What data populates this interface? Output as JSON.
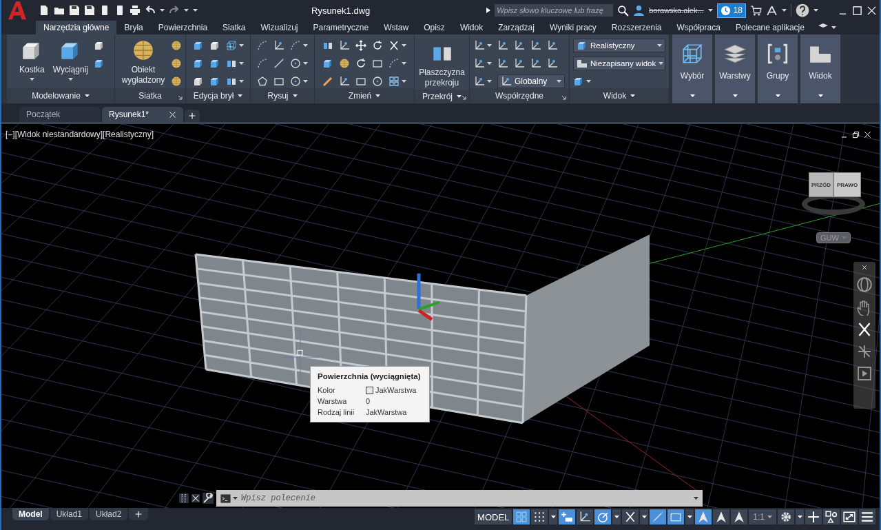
{
  "title_bar": {
    "title": "Rysunek1.dwg",
    "search": {
      "placeholder": "Wpisz słowo kluczowe lub frazę"
    },
    "user": "borawska.alek...",
    "badge": "18"
  },
  "ribbon_tabs": [
    {
      "label": "Narzędzia główne",
      "selected": true
    },
    {
      "label": "Bryła",
      "selected": false
    },
    {
      "label": "Powierzchnia",
      "selected": false
    },
    {
      "label": "Siatka",
      "selected": false
    },
    {
      "label": "Wizualizuj",
      "selected": false
    },
    {
      "label": "Parametryczne",
      "selected": false
    },
    {
      "label": "Wstaw",
      "selected": false
    },
    {
      "label": "Opisz",
      "selected": false
    },
    {
      "label": "Widok",
      "selected": false
    },
    {
      "label": "Zarządzaj",
      "selected": false
    },
    {
      "label": "Wyniki pracy",
      "selected": false
    },
    {
      "label": "Rozszerzenia",
      "selected": false
    },
    {
      "label": "Współpraca",
      "selected": false
    },
    {
      "label": "Polecane aplikacje",
      "selected": false
    }
  ],
  "ribbon_panels": [
    {
      "kind": "modeling",
      "title": "Modelowanie",
      "menu": true,
      "launcher": false,
      "buttons": [
        "Kostka",
        "Wyciągnij"
      ]
    },
    {
      "kind": "mesh",
      "title": "Siatka",
      "menu": false,
      "launcher": true,
      "buttons": [
        "Obiekt wygładzony"
      ]
    },
    {
      "kind": "solid-edit",
      "title": "Edycja brył",
      "menu": true,
      "launcher": false
    },
    {
      "kind": "draw",
      "title": "Rysuj",
      "menu": true,
      "launcher": false
    },
    {
      "kind": "modify",
      "title": "Zmień",
      "menu": true,
      "launcher": false
    },
    {
      "kind": "section",
      "title": "Przekrój",
      "menu": true,
      "launcher": true,
      "buttons": [
        "Płaszczyzna przekroju"
      ]
    },
    {
      "kind": "coords",
      "title": "Współrzędne",
      "menu": false,
      "launcher": true,
      "select": [
        "Globalny"
      ]
    },
    {
      "kind": "view",
      "title": "Widok",
      "menu": true,
      "launcher": false,
      "select": [
        "Realistyczny",
        "Niezapisany widok"
      ]
    },
    {
      "kind": "selection",
      "label": "Wybór"
    },
    {
      "kind": "layers",
      "label": "Warstwy"
    },
    {
      "kind": "groups",
      "label": "Grupy"
    },
    {
      "kind": "views",
      "label": "Widok"
    }
  ],
  "doc_tabs": [
    {
      "label": "Początek",
      "selected": false
    },
    {
      "label": "Rysunek1*",
      "selected": true
    }
  ],
  "viewport": {
    "label": "[−][Widok niestandardowy][Realistyczny]",
    "view_cube": {
      "faces": [
        "PRZÓD",
        "PRAWO"
      ]
    },
    "ucs_menu": "GUW"
  },
  "tooltip": {
    "title": "Powierzchnia (wyciągnięta)",
    "rows": [
      {
        "label": "Kolor",
        "value": "JakWarstwa",
        "swatch": true
      },
      {
        "label": "Warstwa",
        "value": "0",
        "swatch": false
      },
      {
        "label": "Rodzaj linii",
        "value": "JakWarstwa",
        "swatch": false
      }
    ]
  },
  "command_line": {
    "placeholder": "Wpisz polecenie"
  },
  "layout_tabs": [
    {
      "label": "Model",
      "selected": true
    },
    {
      "label": "Układ1",
      "selected": false
    },
    {
      "label": "Układ2",
      "selected": false
    }
  ],
  "status_bar": {
    "model": "MODEL",
    "scale": "1:1",
    "toggles": [
      {
        "on": true,
        "dropdown": false
      },
      {
        "on": false,
        "dropdown": true
      },
      {
        "on": true,
        "dropdown": false
      },
      {
        "on": false,
        "dropdown": false
      },
      {
        "on": true,
        "dropdown": true
      },
      {
        "on": false,
        "dropdown": true
      },
      {
        "on": true,
        "dropdown": false
      },
      {
        "on": true,
        "dropdown": true
      },
      {
        "on": true,
        "dropdown": false
      },
      {
        "on": false,
        "dropdown": false
      },
      {
        "on": false,
        "dropdown": false
      }
    ]
  }
}
